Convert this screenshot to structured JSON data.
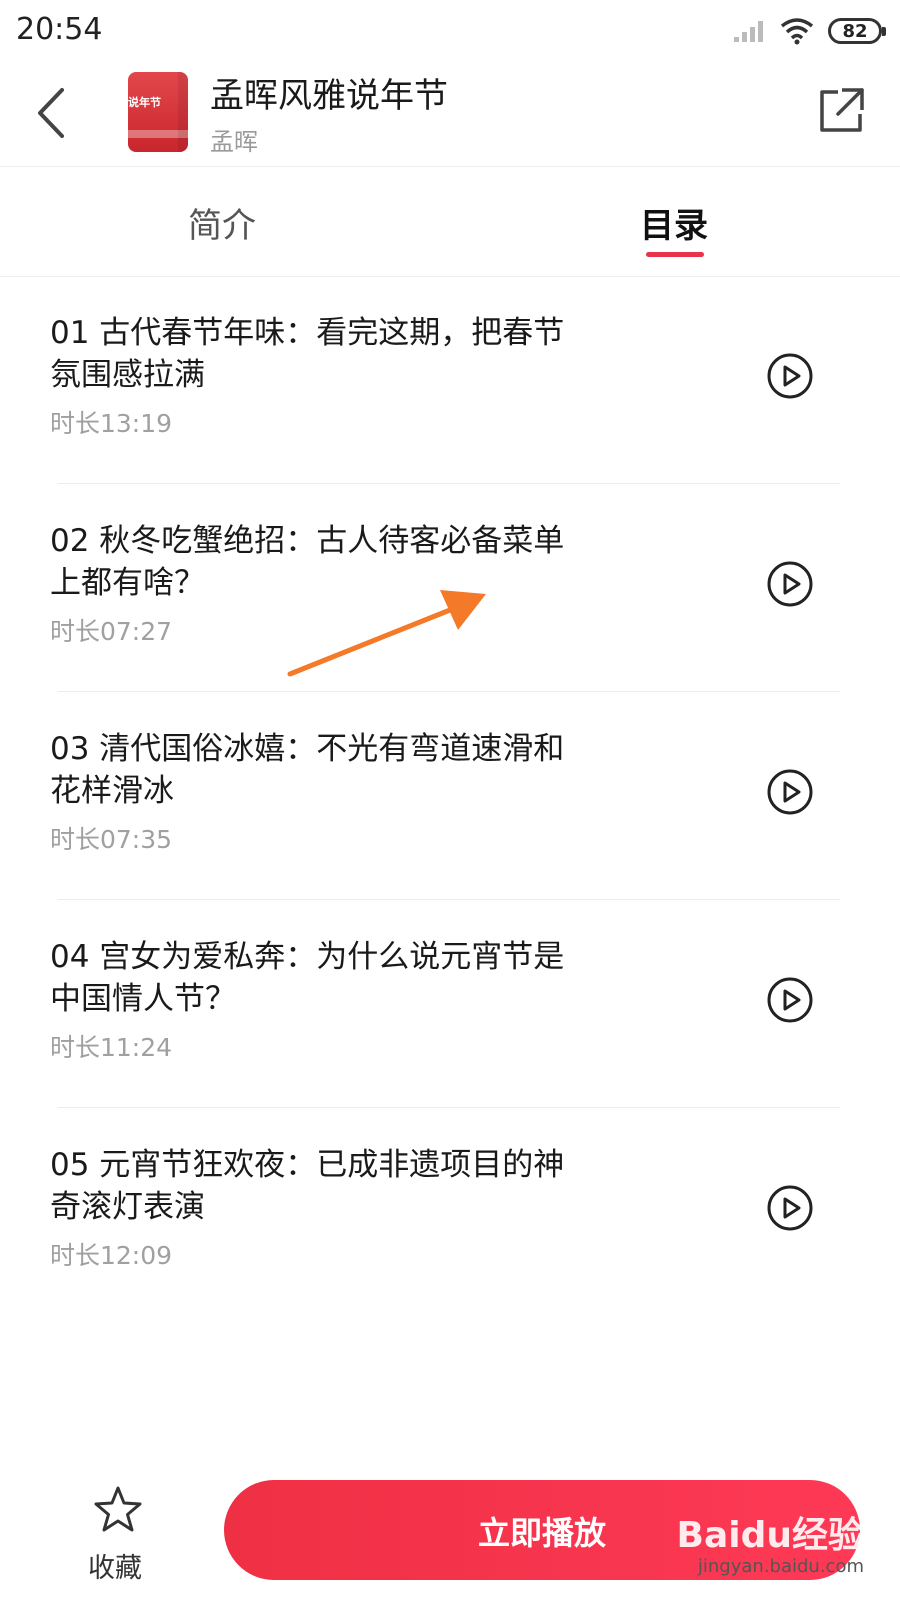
{
  "status_bar": {
    "time": "20:54",
    "battery": "82"
  },
  "header": {
    "album_title": "孟晖风雅说年节",
    "author": "孟晖",
    "cover_text": "说年节"
  },
  "tabs": [
    {
      "label": "简介",
      "active": false
    },
    {
      "label": "目录",
      "active": true
    }
  ],
  "episodes": [
    {
      "title": "01 古代春节年味：看完这期，把春节氛围感拉满",
      "duration": "时长13:19"
    },
    {
      "title": "02 秋冬吃蟹绝招：古人待客必备菜单上都有啥？",
      "duration": "时长07:27"
    },
    {
      "title": "03 清代国俗冰嬉：不光有弯道速滑和花样滑冰",
      "duration": "时长07:35"
    },
    {
      "title": "04 宫女为爱私奔：为什么说元宵节是中国情人节？",
      "duration": "时长11:24"
    },
    {
      "title": "05 元宵节狂欢夜：已成非遗项目的神奇滚灯表演",
      "duration": "时长12:09"
    }
  ],
  "bottom_bar": {
    "favorite_label": "收藏",
    "play_now_label": "立即播放"
  },
  "watermark": {
    "text": "Baidu经验",
    "url": "jingyan.baidu.com"
  },
  "colors": {
    "accent": "#e8344a",
    "button": "#f53249",
    "annotation_arrow": "#f47a2a"
  }
}
